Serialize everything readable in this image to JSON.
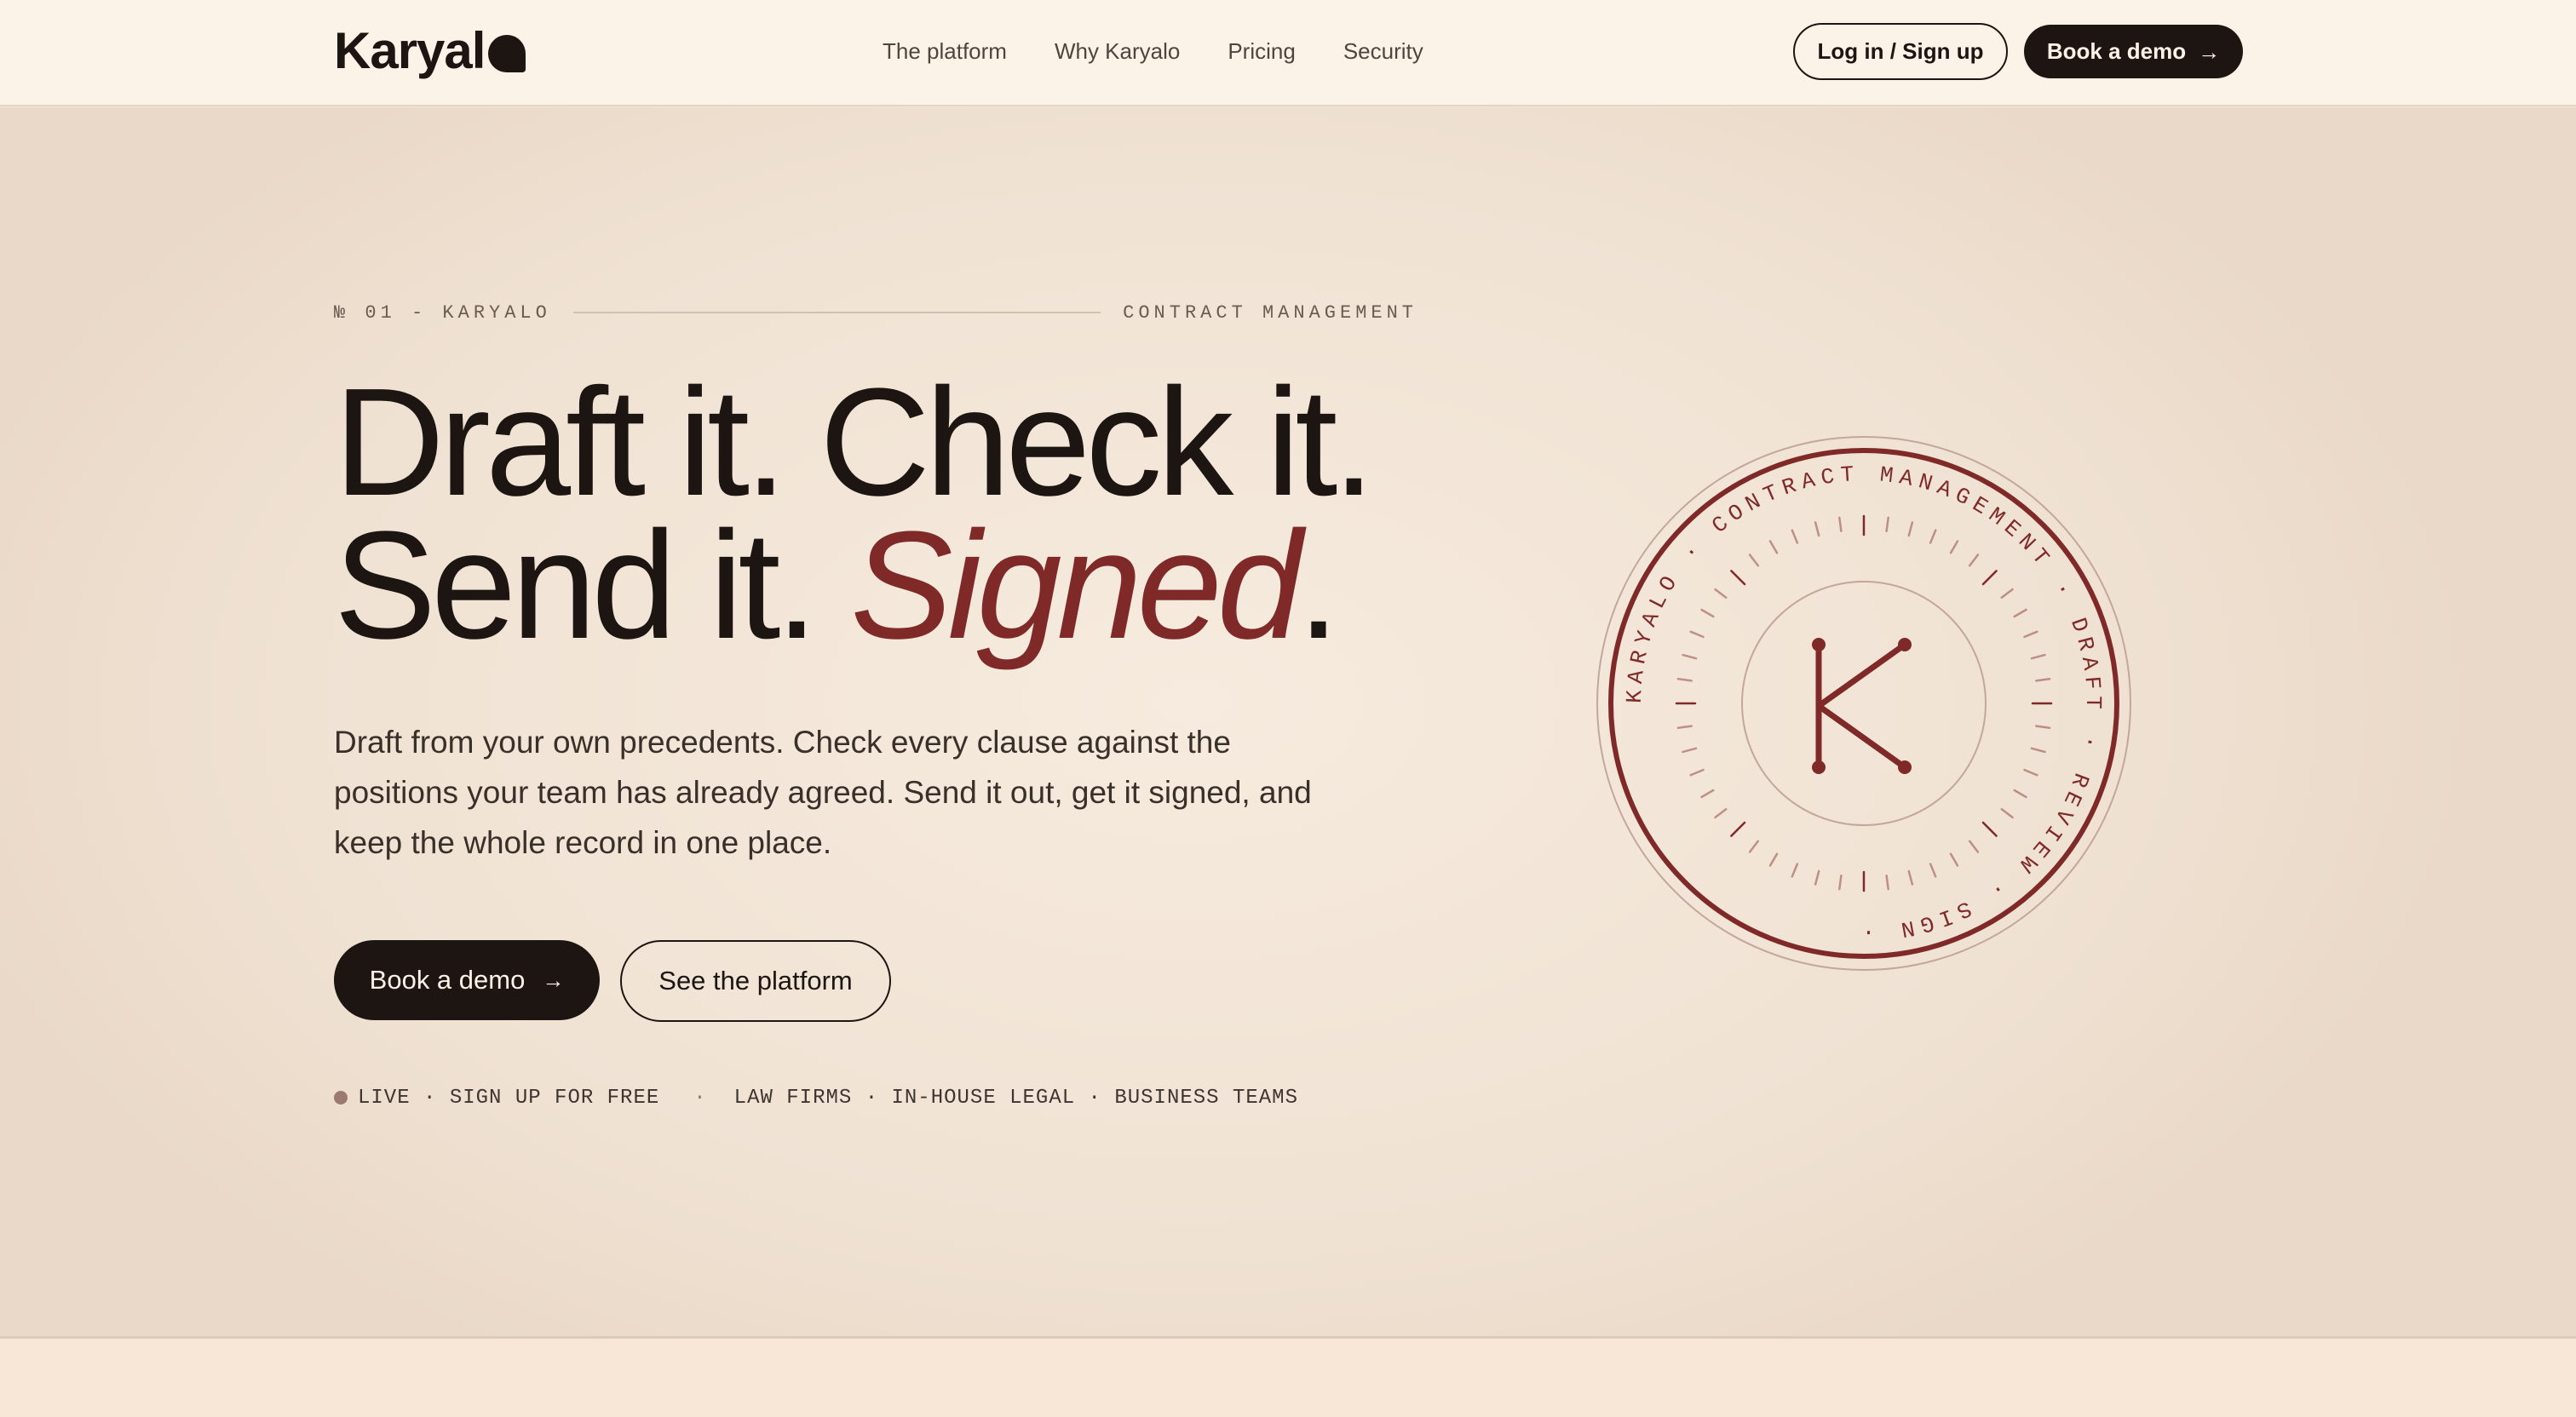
{
  "brand": {
    "name": "Karyal",
    "accent_color": "#7f2a29",
    "ink_color": "#1c1511",
    "background_color": "#fbf2e8"
  },
  "nav": {
    "items": [
      {
        "label": "The platform"
      },
      {
        "label": "Why Karyalo"
      },
      {
        "label": "Pricing"
      },
      {
        "label": "Security"
      }
    ],
    "login_label": "Log in / Sign up",
    "demo_label": "Book a demo",
    "demo_icon": "arrow-right-icon"
  },
  "hero": {
    "kicker_left": "№ 01 - KARYALO",
    "kicker_right": "CONTRACT MANAGEMENT",
    "headline_line1": "Draft it. Check it.",
    "headline_line2_start": "Send it. ",
    "headline_line2_accent": "Signed",
    "headline_line2_end": ".",
    "lede": "Draft from your own precedents. Check every clause against the positions your team has already agreed. Send it out, get it signed, and keep the whole record in one place.",
    "primary_cta": "Book a demo",
    "primary_cta_icon": "arrow-right-icon",
    "secondary_cta": "See the platform",
    "status_left": "LIVE · SIGN UP FOR FREE",
    "status_separator": "·",
    "status_right": "LAW FIRMS · IN-HOUSE LEGAL · BUSINESS TEAMS"
  },
  "seal": {
    "ring_text": "KARYALO · CONTRACT MANAGEMENT · DRAFT · REVIEW · SIGN ·",
    "monogram": "K",
    "icon": "seal-monogram-icon"
  }
}
